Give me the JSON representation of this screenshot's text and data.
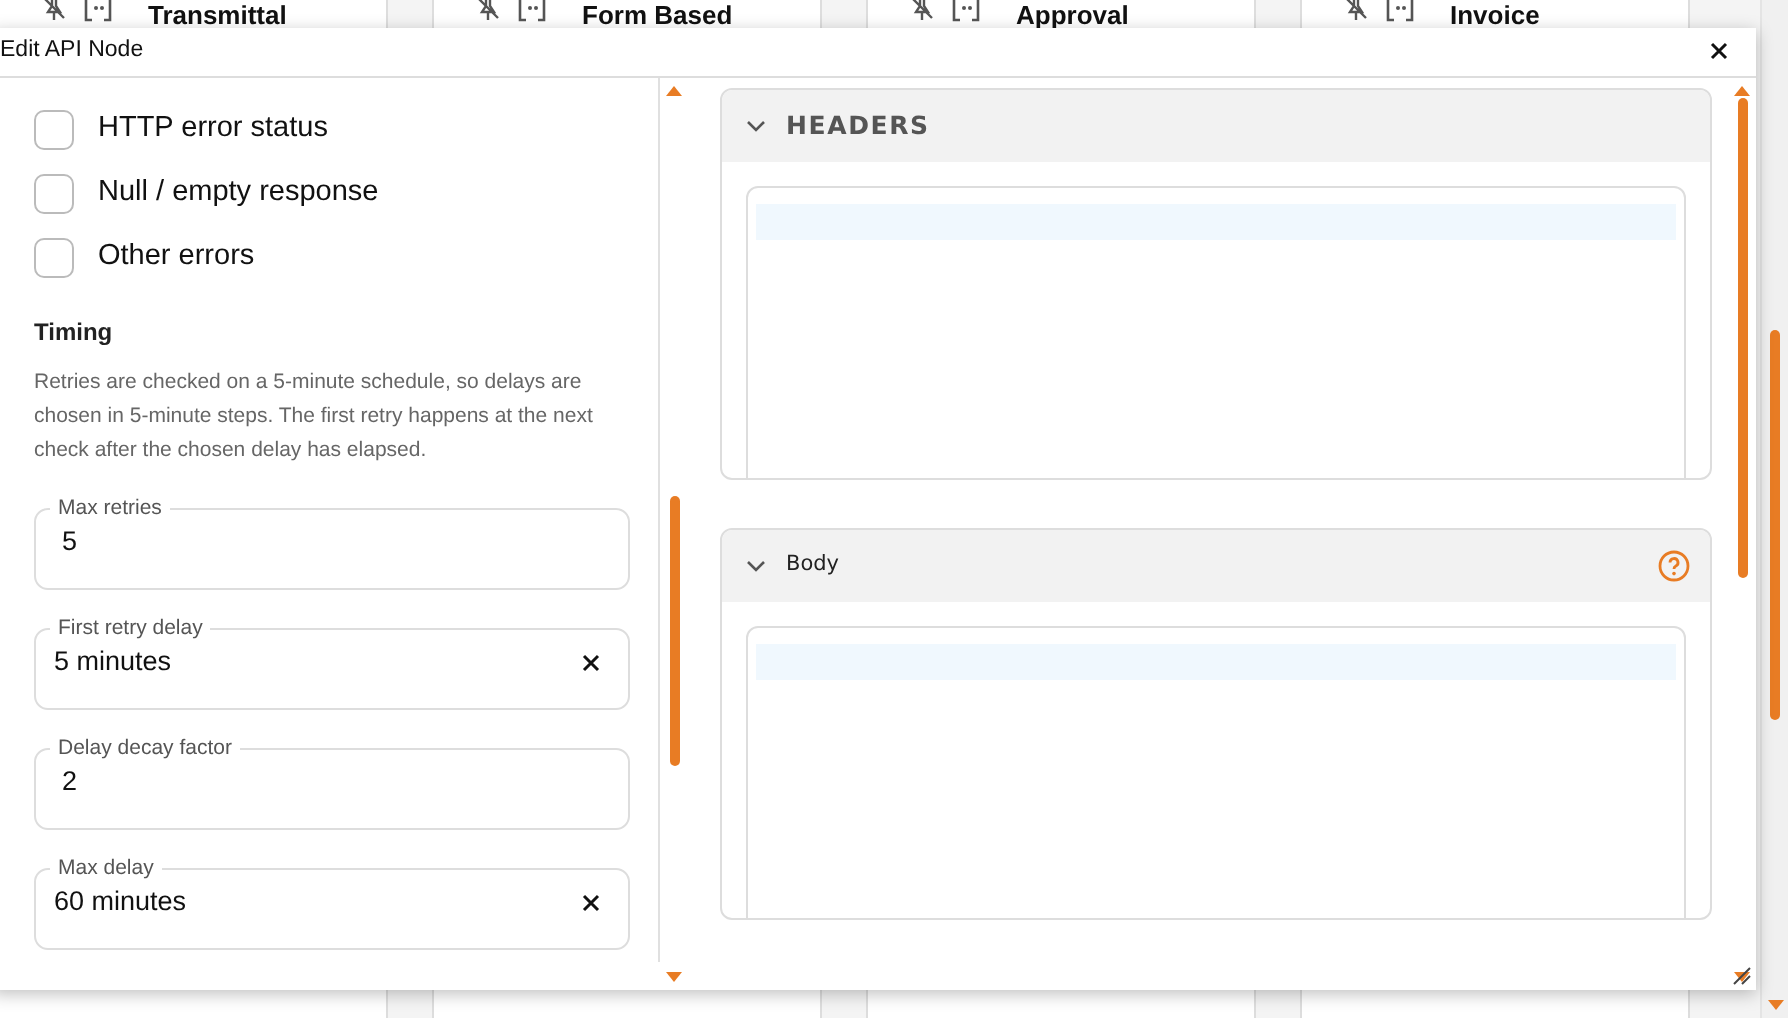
{
  "canvas_nodes": [
    {
      "title": "Transmittal"
    },
    {
      "title": "Form Based"
    },
    {
      "title": "Approval"
    },
    {
      "title": "Invoice"
    }
  ],
  "dialog": {
    "title": "Edit API Node",
    "error_options": [
      {
        "label": "HTTP error status",
        "checked": false
      },
      {
        "label": "Null / empty response",
        "checked": false
      },
      {
        "label": "Other errors",
        "checked": false
      }
    ],
    "timing": {
      "heading": "Timing",
      "description": "Retries are checked on a 5-minute schedule, so delays are chosen in 5-minute steps. The first retry happens at the next check after the chosen delay has elapsed.",
      "fields": [
        {
          "kind": "number",
          "label": "Max retries",
          "value": "5"
        },
        {
          "kind": "select",
          "label": "First retry delay",
          "value": "5 minutes"
        },
        {
          "kind": "number",
          "label": "Delay decay factor",
          "value": "2"
        },
        {
          "kind": "select",
          "label": "Max delay",
          "value": "60 minutes"
        }
      ]
    },
    "sections": [
      {
        "kind": "caps",
        "title": "HEADERS",
        "expanded": true,
        "help": false
      },
      {
        "kind": "plain",
        "title": "Body",
        "expanded": true,
        "help": true
      }
    ]
  }
}
